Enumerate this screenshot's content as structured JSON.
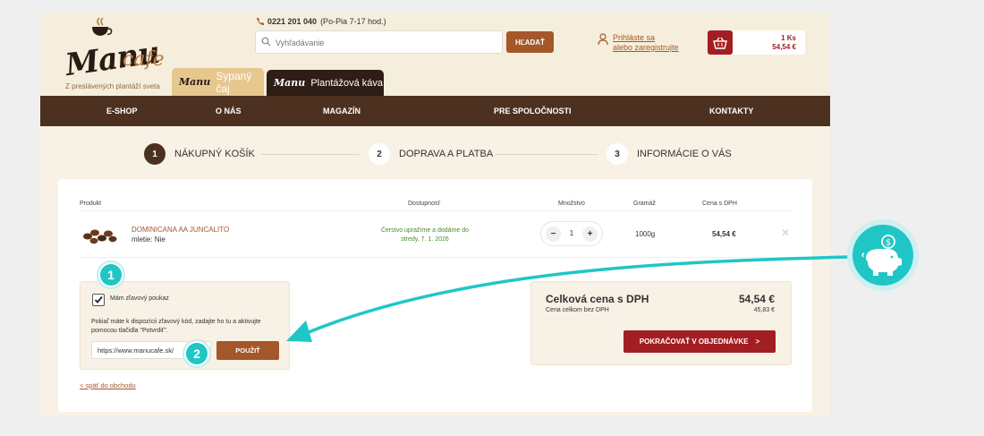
{
  "header": {
    "phone": "0221 201 040",
    "hours": "(Po-Pia 7-17 hod.)",
    "search_placeholder": "Vyhľadávanie",
    "search_button": "HĽADAŤ",
    "login_line1": "Prihláste sa",
    "login_line2": "alebo zaregistrujte",
    "cart_count": "1 Ks",
    "cart_price": "54,54 €"
  },
  "logo": {
    "word1": "Manu",
    "word2": "cafe",
    "slogan": "Z preslávených plantáží sveta"
  },
  "tabs": [
    {
      "label": "Sypaný čaj"
    },
    {
      "label": "Plantážová káva"
    }
  ],
  "nav": [
    "E-SHOP",
    "O NÁS",
    "MAGAZÍN",
    "PRE SPOLOČNOSTI",
    "KONTAKTY"
  ],
  "steps": [
    {
      "num": "1",
      "label": "NÁKUPNÝ KOŠÍK"
    },
    {
      "num": "2",
      "label": "DOPRAVA A PLATBA"
    },
    {
      "num": "3",
      "label": "INFORMÁCIE O VÁS"
    }
  ],
  "table": {
    "headers": {
      "product": "Produkt",
      "availability": "Dostupnosť",
      "quantity": "Množstvo",
      "weight": "Gramáž",
      "price": "Cena s DPH"
    },
    "row": {
      "name": "DOMINICANA AA JUNCALITO",
      "grind": "mletie: Nie",
      "availability": "Čerstvo upražíme a dodáme do stredy, 7. 1. 2026",
      "qty": "1",
      "weight": "1000g",
      "price": "54,54 €",
      "minus": "−",
      "plus": "+",
      "remove": "✕"
    }
  },
  "voucher": {
    "checkbox_label": "Mám zľavový poukaz",
    "text": "Pokiaľ máte k dispozícii zľavový kód, zadajte ho tu a aktivujte pomocou tlačidla \"Potvrdiť\".",
    "input_value": "https://www.manucafe.sk/",
    "apply_button": "POUŽIŤ"
  },
  "totals": {
    "label": "Celková cena s DPH",
    "value": "54,54 €",
    "sub_label": "Cena celkom bez DPH",
    "sub_value": "45,83 €",
    "continue_button": "POKRAČOVAŤ V OBJEDNÁVKE",
    "continue_arrow": ">"
  },
  "back_link": "< späť do obchodu",
  "annotations": {
    "badge1": "1",
    "badge2": "2",
    "accent_color": "#20c6c6"
  },
  "icons": {
    "pig": "piggy-bank-icon",
    "cart": "basket-icon",
    "user": "user-icon",
    "phone": "phone-icon",
    "search": "search-icon"
  }
}
